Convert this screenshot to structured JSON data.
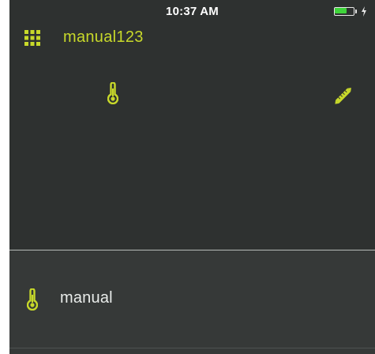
{
  "status_bar": {
    "time": "10:37 AM",
    "battery_level": 0.7
  },
  "header": {
    "title": "manual123",
    "menu_icon": "grid-icon"
  },
  "detail": {
    "sensor_icon": "thermometer-icon",
    "edit_icon": "pencil-icon"
  },
  "list": {
    "items": [
      {
        "label": "manual",
        "icon": "thermometer-icon"
      }
    ]
  },
  "colors": {
    "accent": "#c8d92a",
    "background": "#2e3130",
    "panel": "#363938",
    "battery_green": "#3fd43b",
    "text_light": "#e9ecea"
  }
}
